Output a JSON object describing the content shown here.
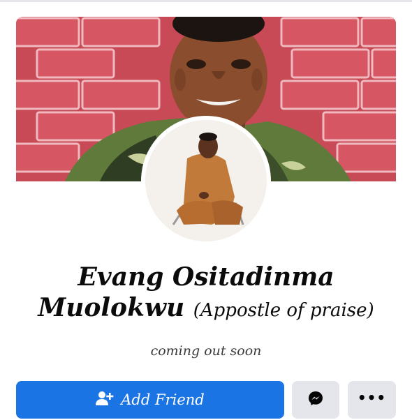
{
  "profile": {
    "name_line1": "Evang Ositadinma",
    "name_line2": "Muolokwu",
    "alias": "(Appostle of praise)",
    "bio": "coming out soon"
  },
  "actions": {
    "add_friend_label": "Add Friend",
    "add_friend_icon": "add-person-icon",
    "message_icon": "messenger-icon",
    "more_label": "•••",
    "more_icon": "more-dots-icon"
  },
  "colors": {
    "primary_button": "#1b74e4",
    "secondary_button": "#e4e6eb",
    "cover_wall": "#c44a55",
    "text": "#0b0b0b"
  }
}
